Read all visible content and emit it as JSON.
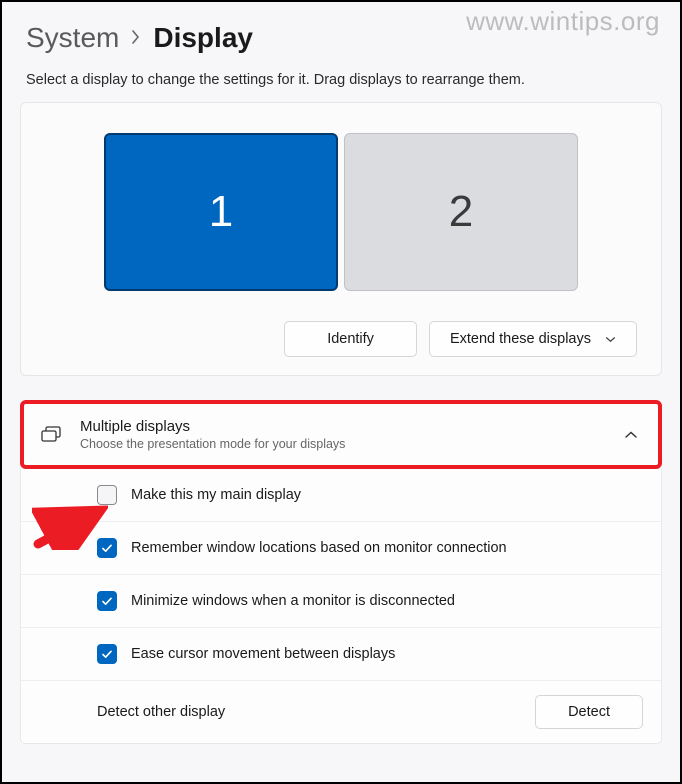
{
  "watermark": "www.wintips.org",
  "breadcrumb": {
    "parent": "System",
    "current": "Display"
  },
  "subtitle": "Select a display to change the settings for it. Drag displays to rearrange them.",
  "monitors": {
    "m1_label": "1",
    "m2_label": "2"
  },
  "buttons": {
    "identify": "Identify",
    "extend": "Extend these displays",
    "detect": "Detect"
  },
  "expander": {
    "title": "Multiple displays",
    "desc": "Choose the presentation mode for your displays"
  },
  "options": {
    "main_display": "Make this my main display",
    "remember": "Remember window locations based on monitor connection",
    "minimize": "Minimize windows when a monitor is disconnected",
    "ease_cursor": "Ease cursor movement between displays",
    "detect_label": "Detect other display"
  }
}
